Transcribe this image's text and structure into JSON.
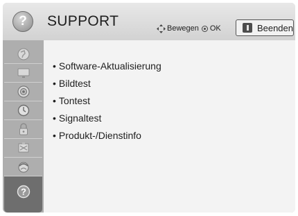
{
  "header": {
    "title": "SUPPORT",
    "help_icon_glyph": "?",
    "nav_hint": {
      "move_label": "Bewegen",
      "ok_label": "OK"
    },
    "exit_label": "Beenden"
  },
  "sidebar": {
    "items": [
      {
        "icon": "picture-icon"
      },
      {
        "icon": "tv-icon"
      },
      {
        "icon": "speaker-icon"
      },
      {
        "icon": "clock-icon"
      },
      {
        "icon": "lock-icon"
      },
      {
        "icon": "settings-icon"
      },
      {
        "icon": "network-icon"
      },
      {
        "icon": "help-icon",
        "active": true
      }
    ]
  },
  "menu": {
    "bullet": "•",
    "items": [
      {
        "label": "Software-Aktualisierung"
      },
      {
        "label": "Bildtest"
      },
      {
        "label": "Tontest"
      },
      {
        "label": "Signaltest"
      },
      {
        "label": "Produkt-/Dienstinfo"
      }
    ]
  },
  "colors": {
    "header_bg": "#dddddd",
    "sidebar_bg": "#aeaeae",
    "sidebar_active": "#6e6e6e",
    "content_bg": "#f3f3f3",
    "text": "#1e1e1e"
  }
}
